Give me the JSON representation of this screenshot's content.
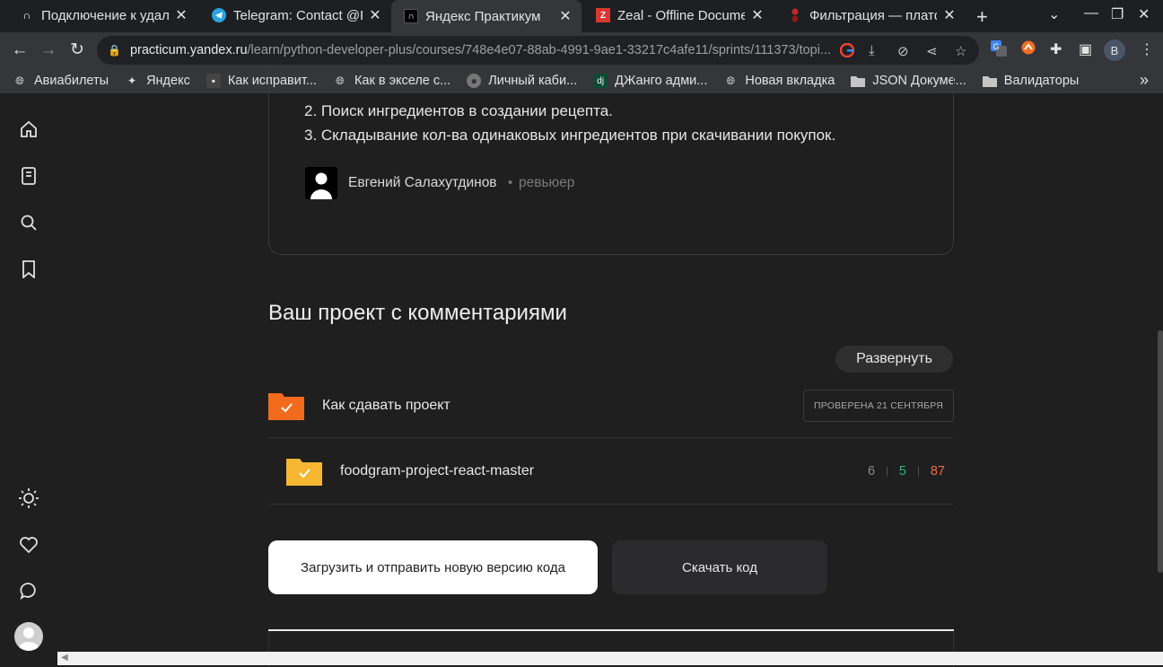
{
  "browser": {
    "tabs": [
      {
        "title": "Подключение к удал",
        "icon": "practicum-icon",
        "active": false
      },
      {
        "title": "Telegram: Contact @F",
        "icon": "telegram-icon",
        "active": false
      },
      {
        "title": "Яндекс Практикум",
        "icon": "practicum-icon",
        "active": true
      },
      {
        "title": "Zeal - Offline Docume",
        "icon": "zeal-icon",
        "active": false
      },
      {
        "title": "Фильтрация — платф",
        "icon": "django-icon",
        "active": false
      }
    ],
    "url_domain": "practicum.yandex.ru",
    "url_path": "/learn/python-developer-plus/courses/748e4e07-88ab-4991-9ae1-33217c4afe11/sprints/111373/topi...",
    "profile_initial": "В",
    "bookmarks": [
      {
        "label": "Авиабилеты",
        "icon": "globe-icon"
      },
      {
        "label": "Яндекс",
        "icon": "yandex-star-icon"
      },
      {
        "label": "Как исправит...",
        "icon": "site-icon"
      },
      {
        "label": "Как в экселе с...",
        "icon": "globe-icon"
      },
      {
        "label": "Личный каби...",
        "icon": "user-icon"
      },
      {
        "label": "ДЖанго адми...",
        "icon": "django-icon"
      },
      {
        "label": "Новая вкладка",
        "icon": "globe-icon"
      },
      {
        "label": "JSON Докуме...",
        "icon": "folder-icon"
      },
      {
        "label": "Валидаторы",
        "icon": "folder-icon"
      }
    ]
  },
  "review": {
    "item2": "2. Поиск ингредиентов в создании рецепта.",
    "item3": "3. Складывание кол-ва одинаковых ингредиентов при скачивании покупок.",
    "reviewer_name": "Евгений Салахутдинов",
    "separator": "•",
    "reviewer_role": "ревьюер"
  },
  "project": {
    "heading": "Ваш проект с комментариями",
    "expand_label": "Развернуть",
    "row1": {
      "label": "Как сдавать проект",
      "badge": "ПРОВЕРЕНА 21 СЕНТЯБРЯ",
      "folder_color": "#f26b1d"
    },
    "row2": {
      "label": "foodgram-project-react-master",
      "folder_color": "#f5b731",
      "stats": [
        {
          "value": "6",
          "color": "#8a8a8a"
        },
        {
          "value": "5",
          "color": "#2fb67c"
        },
        {
          "value": "87",
          "color": "#f06a4c"
        }
      ],
      "stat_separator": "|"
    },
    "upload_label": "Загрузить и отправить новую версию кода",
    "download_label": "Скачать код"
  }
}
